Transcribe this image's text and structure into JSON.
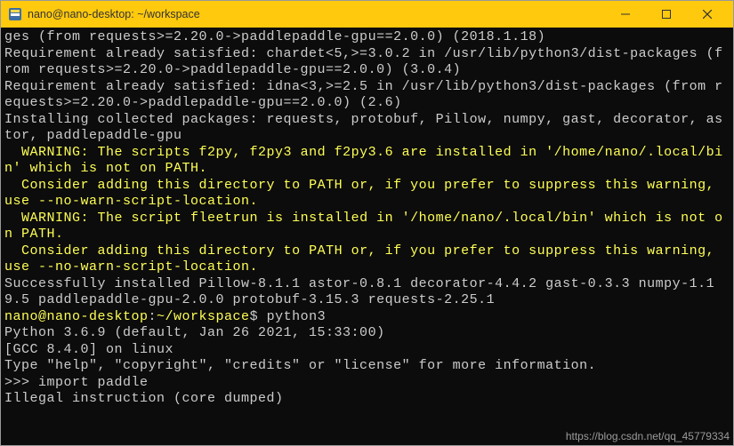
{
  "titlebar": {
    "title": "nano@nano-desktop: ~/workspace"
  },
  "terminal": {
    "lines": [
      {
        "text": "ges (from requests>=2.20.0->paddlepaddle-gpu==2.0.0) (2018.1.18)",
        "cls": "white"
      },
      {
        "text": "Requirement already satisfied: chardet<5,>=3.0.2 in /usr/lib/python3/dist-packages (from requests>=2.20.0->paddlepaddle-gpu==2.0.0) (3.0.4)",
        "cls": "white"
      },
      {
        "text": "Requirement already satisfied: idna<3,>=2.5 in /usr/lib/python3/dist-packages (from requests>=2.20.0->paddlepaddle-gpu==2.0.0) (2.6)",
        "cls": "white"
      },
      {
        "text": "Installing collected packages: requests, protobuf, Pillow, numpy, gast, decorator, astor, paddlepaddle-gpu",
        "cls": "white"
      },
      {
        "text": "  WARNING: The scripts f2py, f2py3 and f2py3.6 are installed in '/home/nano/.local/bin' which is not on PATH.",
        "cls": "yellow"
      },
      {
        "text": "  Consider adding this directory to PATH or, if you prefer to suppress this warning, use --no-warn-script-location.",
        "cls": "yellow"
      },
      {
        "text": "  WARNING: The script fleetrun is installed in '/home/nano/.local/bin' which is not on PATH.",
        "cls": "yellow"
      },
      {
        "text": "  Consider adding this directory to PATH or, if you prefer to suppress this warning, use --no-warn-script-location.",
        "cls": "yellow"
      },
      {
        "text": "Successfully installed Pillow-8.1.1 astor-0.8.1 decorator-4.4.2 gast-0.3.3 numpy-1.19.5 paddlepaddle-gpu-2.0.0 protobuf-3.15.3 requests-2.25.1",
        "cls": "white"
      }
    ],
    "prompt": {
      "user_host": "nano@nano-desktop",
      "path": "~/workspace",
      "command": "python3"
    },
    "python_banner": [
      "Python 3.6.9 (default, Jan 26 2021, 15:33:00)",
      "[GCC 8.4.0] on linux",
      "Type \"help\", \"copyright\", \"credits\" or \"license\" for more information."
    ],
    "python_prompt": ">>> ",
    "python_input": "import paddle",
    "python_error": "Illegal instruction (core dumped)"
  },
  "watermark": "https://blog.csdn.net/qq_45779334"
}
